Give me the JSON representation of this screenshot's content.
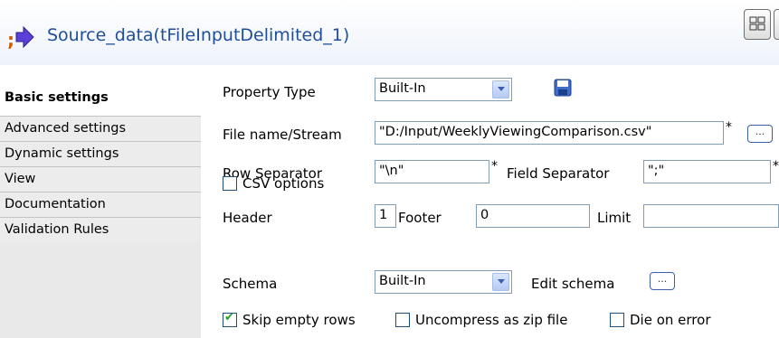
{
  "header": {
    "title": "Source_data(tFileInputDelimited_1)"
  },
  "sidebar": {
    "items": [
      {
        "label": "Basic settings"
      },
      {
        "label": "Advanced settings"
      },
      {
        "label": "Dynamic settings"
      },
      {
        "label": "View"
      },
      {
        "label": "Documentation"
      },
      {
        "label": "Validation Rules"
      }
    ]
  },
  "form": {
    "property_type_label": "Property Type",
    "property_type_value": "Built-In",
    "file_name_label": "File name/Stream",
    "file_name_value": "\"D:/Input/WeeklyViewingComparison.csv\"",
    "required_mark": "*",
    "browse_label": "...",
    "row_separator_label": "Row Separator",
    "row_separator_value": "\"\\n\"",
    "field_separator_label": "Field Separator",
    "field_separator_value": "\";\"",
    "csv_options_label": "CSV options",
    "header_label": "Header",
    "header_value": "1",
    "footer_label": "Footer",
    "footer_value": "0",
    "limit_label": "Limit",
    "limit_value": "",
    "schema_label": "Schema",
    "schema_value": "Built-In",
    "edit_schema_label": "Edit schema",
    "edit_schema_btn": "...",
    "skip_empty_rows_label": "Skip empty rows",
    "uncompress_label": "Uncompress as zip file",
    "die_on_error_label": "Die on error"
  },
  "state": {
    "csv_options_checked": false,
    "skip_empty_rows_checked": true,
    "uncompress_checked": false,
    "die_on_error_checked": false
  },
  "colors": {
    "title": "#1f4e9b",
    "checkmark": "#21a121"
  }
}
